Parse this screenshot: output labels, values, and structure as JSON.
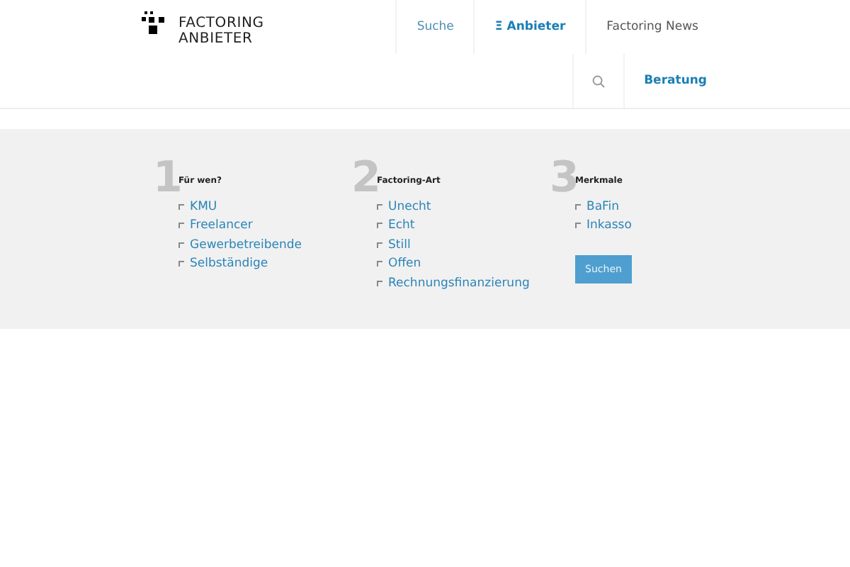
{
  "logo": {
    "lines": [
      "FACTORING",
      "ANBIETER"
    ]
  },
  "nav": [
    {
      "label": "Suche",
      "selected": false
    },
    {
      "label": "Anbieter",
      "icon": "Ξ",
      "selected": true
    },
    {
      "label": "Factoring News",
      "selected": false
    }
  ],
  "nav_row2": [
    {
      "kind": "search"
    },
    {
      "kind": "text",
      "label": "Beratung",
      "bold": true
    }
  ],
  "filters": [
    {
      "number": "1",
      "title": "Für wen?",
      "options": [
        {
          "label": "KMU",
          "checked": false
        },
        {
          "label": "Freelancer",
          "checked": false
        },
        {
          "label": "Gewerbetreibende",
          "checked": false
        },
        {
          "label": "Selbständige",
          "checked": false
        }
      ]
    },
    {
      "number": "2",
      "title": "Factoring-Art",
      "options": [
        {
          "label": "Unecht",
          "checked": false
        },
        {
          "label": "Echt",
          "checked": false
        },
        {
          "label": "Still",
          "checked": false
        },
        {
          "label": "Offen",
          "checked": false
        },
        {
          "label": "Rechnungsfinanzierung",
          "checked": false
        }
      ]
    },
    {
      "number": "3",
      "title": "Merkmale",
      "options": [
        {
          "label": "BaFin",
          "checked": false
        },
        {
          "label": "Inkasso",
          "checked": false
        }
      ],
      "button": "Suchen"
    }
  ]
}
